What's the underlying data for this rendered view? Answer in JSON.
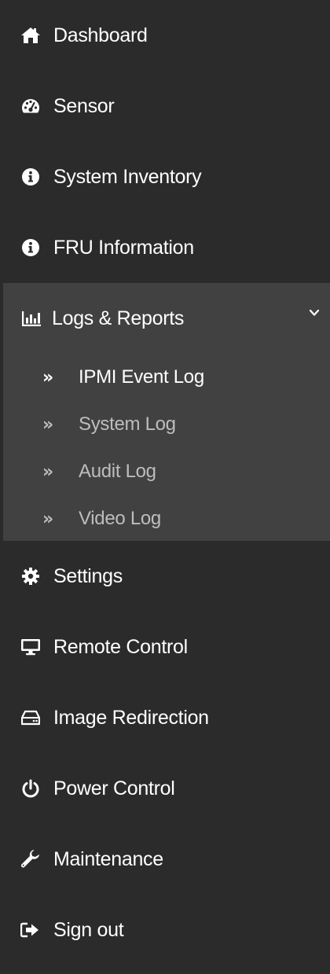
{
  "colors": {
    "background": "#2b2b2b",
    "expanded_group_background": "#414141",
    "text_active": "#ffffff",
    "text_inactive": "#bdbdbd"
  },
  "menu": {
    "dashboard": {
      "label": "Dashboard",
      "icon": "home-icon"
    },
    "sensor": {
      "label": "Sensor",
      "icon": "tachometer-icon"
    },
    "system_inventory": {
      "label": "System Inventory",
      "icon": "info-circle-icon"
    },
    "fru_information": {
      "label": "FRU Information",
      "icon": "info-circle-icon"
    },
    "logs_reports": {
      "label": "Logs & Reports",
      "icon": "bar-chart-icon",
      "expanded": true,
      "items": [
        {
          "label": "IPMI Event Log",
          "active": true
        },
        {
          "label": "System Log",
          "active": false
        },
        {
          "label": "Audit Log",
          "active": false
        },
        {
          "label": "Video Log",
          "active": false
        }
      ]
    },
    "settings": {
      "label": "Settings",
      "icon": "gear-icon"
    },
    "remote_control": {
      "label": "Remote Control",
      "icon": "monitor-icon"
    },
    "image_redirection": {
      "label": "Image Redirection",
      "icon": "hdd-icon"
    },
    "power_control": {
      "label": "Power Control",
      "icon": "power-icon"
    },
    "maintenance": {
      "label": "Maintenance",
      "icon": "wrench-icon"
    },
    "sign_out": {
      "label": "Sign out",
      "icon": "sign-out-icon"
    }
  },
  "glyphs": {
    "submenu_arrow": "»"
  }
}
